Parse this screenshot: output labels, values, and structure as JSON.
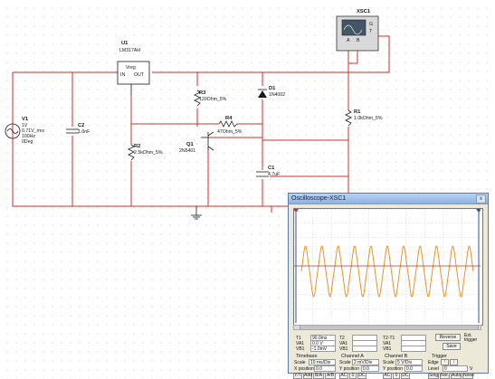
{
  "schematic": {
    "regulator": {
      "ref": "U1",
      "part": "LM317AH",
      "pin_vreg": "Vreg",
      "pin_in": "IN",
      "pin_out": "OUT"
    },
    "source": {
      "ref": "V1",
      "lines": [
        "1V",
        "0.71V_rms",
        "100Hz",
        "0Deg"
      ]
    },
    "c2": {
      "ref": "C2",
      "value": "1.0nF"
    },
    "r2": {
      "ref": "R2",
      "value": "2.5kOhm_5%"
    },
    "r3": {
      "ref": "R3",
      "value": "120Ohm_5%"
    },
    "r4": {
      "ref": "R4",
      "value": "47Ohm_5%"
    },
    "d1": {
      "ref": "D1",
      "value": "1N4002"
    },
    "q1": {
      "ref": "Q1",
      "value": "2N5401"
    },
    "c1": {
      "ref": "C1",
      "value": "4.7uF"
    },
    "r1": {
      "ref": "R1",
      "value": "1.0kOhm_5%"
    },
    "xsc1": {
      "ref": "XSC1",
      "pins": [
        "A",
        "B",
        "G",
        "T"
      ]
    }
  },
  "oscilloscope": {
    "title": "Oscilloscope-XSC1",
    "close_glyph": "x",
    "trace_color": "#e8922a",
    "cursor_color": "#3050a0",
    "measure": {
      "t1": {
        "label": "T1",
        "time": "90.0ms",
        "vala": "0.0 V",
        "valb": "-1.0mV"
      },
      "t2": {
        "label": "T2"
      },
      "t2t1": {
        "label": "T2-T1"
      },
      "vala_label": "VA1",
      "valb_label": "VB1",
      "reverse_label": "Reverse",
      "save_label": "Save",
      "ext_label": "Ext. trigger"
    },
    "timebase": {
      "title": "Timebase",
      "scale_label": "Scale",
      "scale_value": "10 ms/Div",
      "xpos_label": "X position",
      "xpos_value": "0.0",
      "modes": [
        "Y/T",
        "Add",
        "B/A",
        "A/B"
      ]
    },
    "channel_a": {
      "title": "Channel A",
      "scale_label": "Scale",
      "scale_value": "2 mV/Div",
      "ypos_label": "Y position",
      "ypos_value": "0.0",
      "coupling": [
        "AC",
        "0",
        "DC"
      ]
    },
    "channel_b": {
      "title": "Channel B",
      "scale_label": "Scale",
      "scale_value": "5 V/Div",
      "ypos_label": "Y position",
      "ypos_value": "0.0",
      "coupling": [
        "AC",
        "0",
        "DC"
      ]
    },
    "trigger": {
      "title": "Trigger",
      "edge_label": "Edge",
      "level_label": "Level",
      "level_value": "0",
      "level_unit": "V",
      "modes": [
        "Sing.",
        "Nor.",
        "Auto",
        "None"
      ]
    }
  }
}
